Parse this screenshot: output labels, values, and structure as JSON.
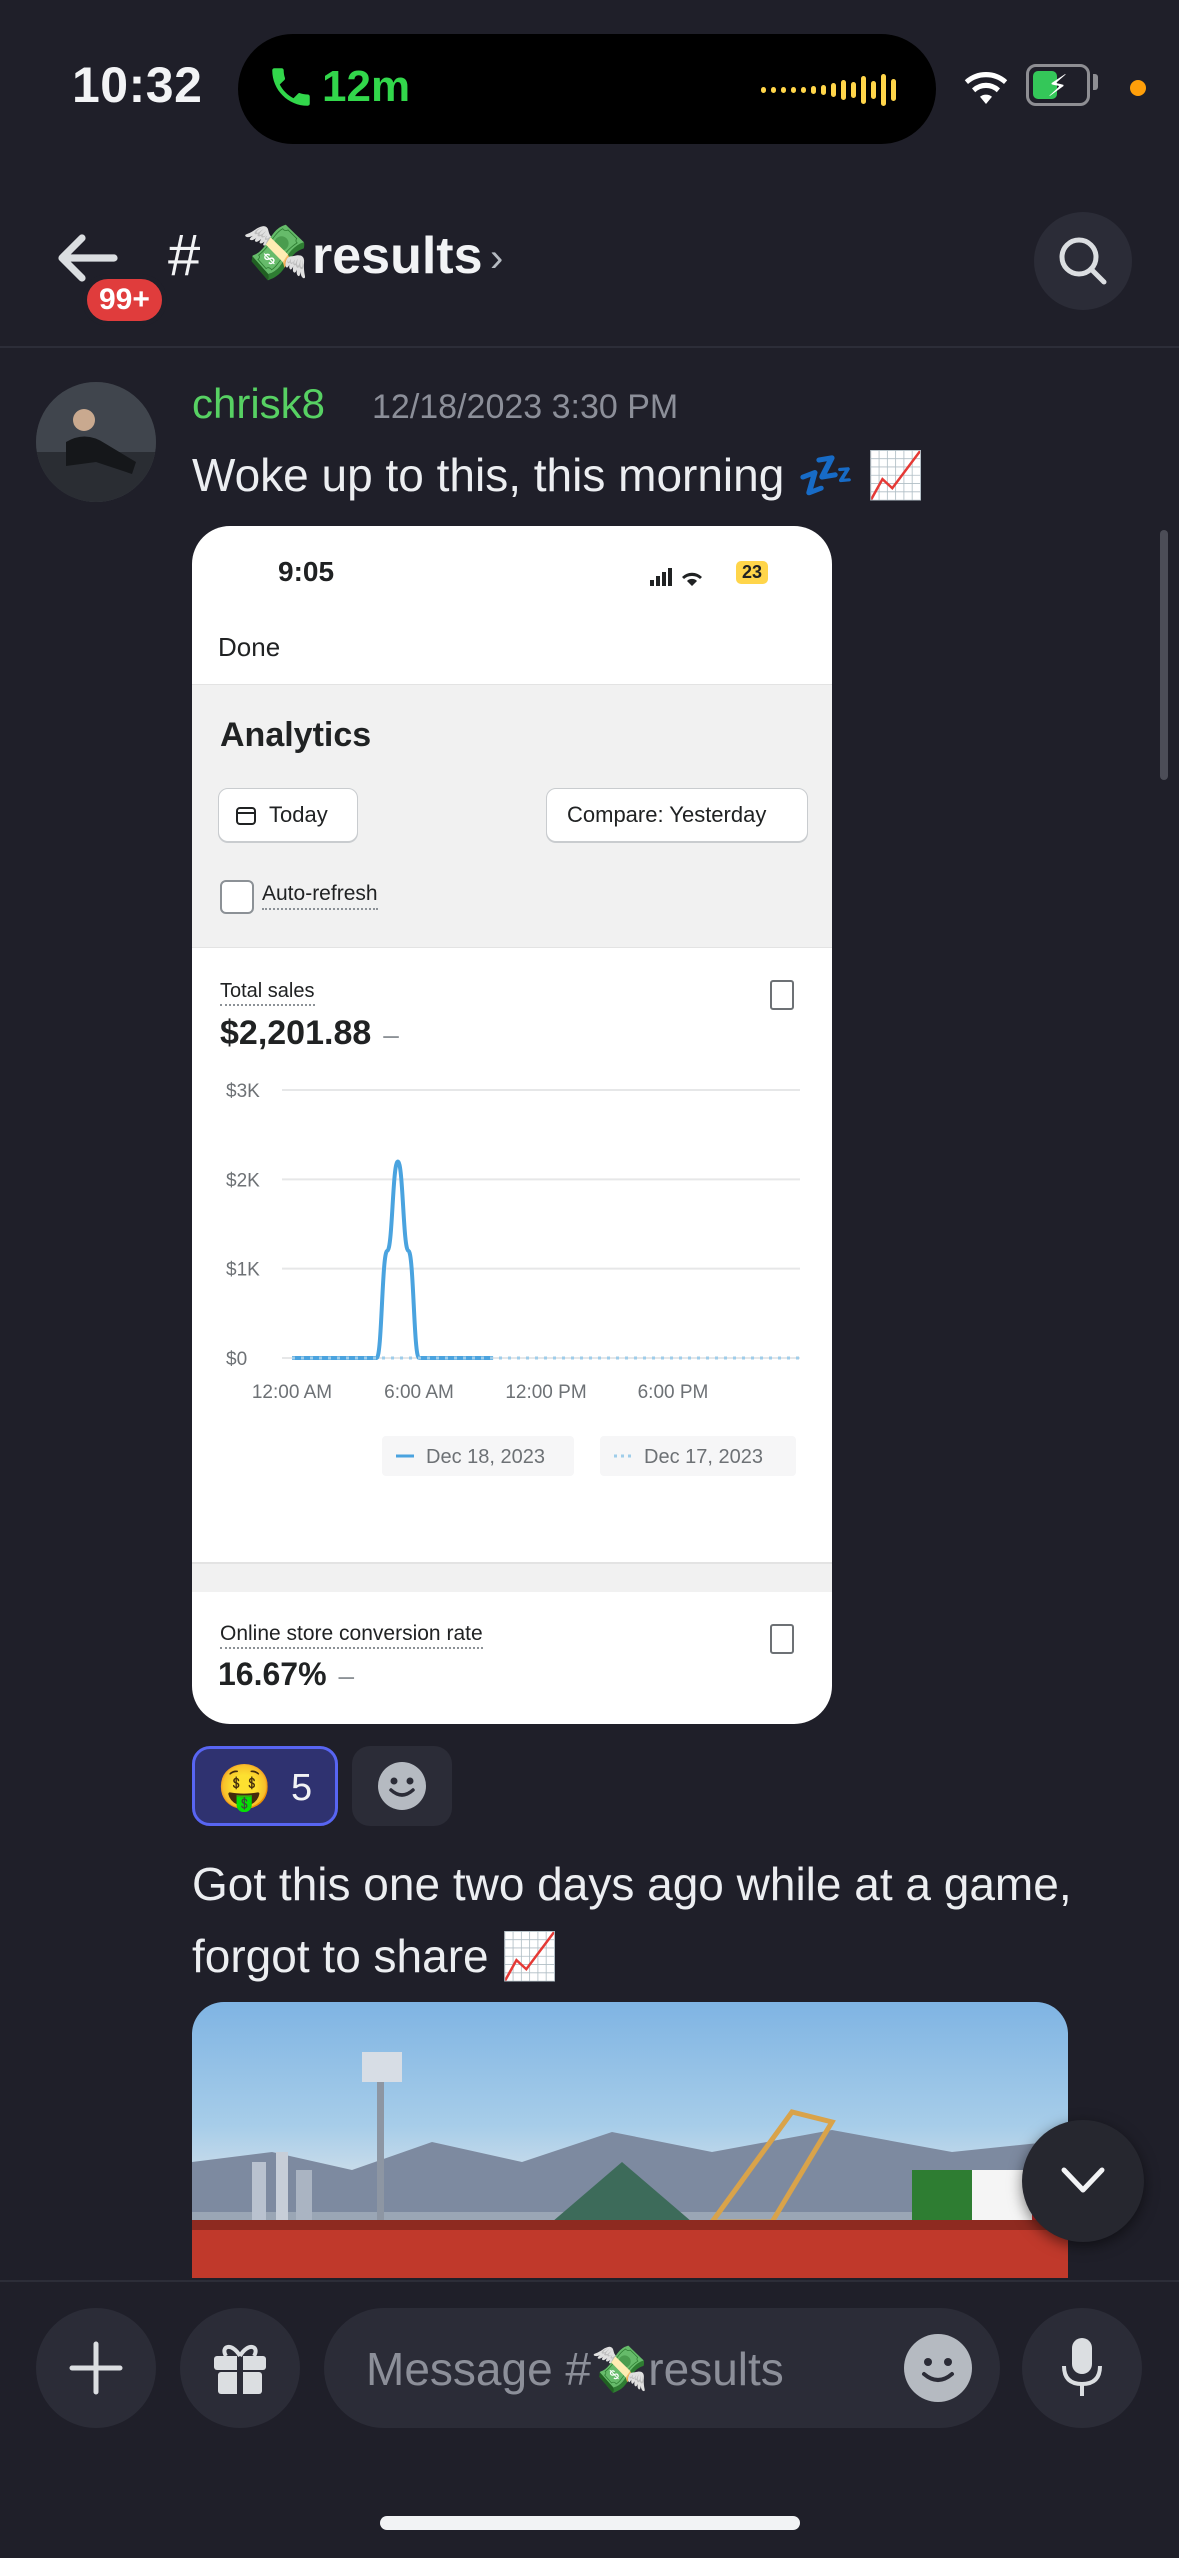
{
  "status_bar": {
    "time": "10:32",
    "call_duration": "12m",
    "battery_color": "#34c759"
  },
  "header": {
    "unread_badge": "99+",
    "channel_hash": "#",
    "channel_emoji": "💸",
    "channel_name": "results",
    "chevron": "›",
    "icons": [
      "back-arrow-icon",
      "search-icon"
    ]
  },
  "message": {
    "username": "chrisk8",
    "username_color": "#57d163",
    "timestamp": "12/18/2023 3:30 PM",
    "text1": "Woke up to this,  this morning 💤 📈",
    "attachment_screenshot": {
      "time": "9:05",
      "battery": "23",
      "done_label": "Done",
      "title": "Analytics",
      "today_label": "Today",
      "compare_label": "Compare: Yesterday",
      "auto_refresh_label": "Auto-refresh",
      "total_sales_label": "Total sales",
      "total_sales_value": "$2,201.88",
      "dash": "–",
      "conversion_label": "Online store conversion rate",
      "conversion_value": "16.67%"
    },
    "reaction": {
      "emoji": "🤑",
      "count": "5"
    },
    "text2": "Got this one two days ago while at a game, forgot to share 📈"
  },
  "chart_data": {
    "type": "line",
    "title": "Total sales",
    "x_ticks": [
      "12:00 AM",
      "6:00 AM",
      "12:00 PM",
      "6:00 PM"
    ],
    "y_ticks": [
      "$3K",
      "$2K",
      "$1K",
      "$0"
    ],
    "ylim": [
      0,
      3000
    ],
    "x_hours": [
      0,
      3,
      4,
      4.5,
      5,
      5.5,
      6,
      7,
      9.5
    ],
    "series": [
      {
        "name": "Dec 18, 2023",
        "style": "solid",
        "color": "#4aa3df",
        "x": [
          0,
          3,
          4,
          4.5,
          5,
          5.5,
          6,
          7,
          9.5
        ],
        "values": [
          0,
          0,
          0,
          1200,
          2200,
          1200,
          0,
          0,
          0
        ]
      },
      {
        "name": "Dec 17, 2023",
        "style": "dotted",
        "color": "#9fcdea",
        "x": [
          0,
          24
        ],
        "values": [
          0,
          0
        ]
      }
    ],
    "legend": [
      "Dec 18, 2023",
      "Dec 17, 2023"
    ],
    "legend_placement": "bottom-right",
    "grid": true
  },
  "composer": {
    "placeholder": "Message #💸results"
  }
}
